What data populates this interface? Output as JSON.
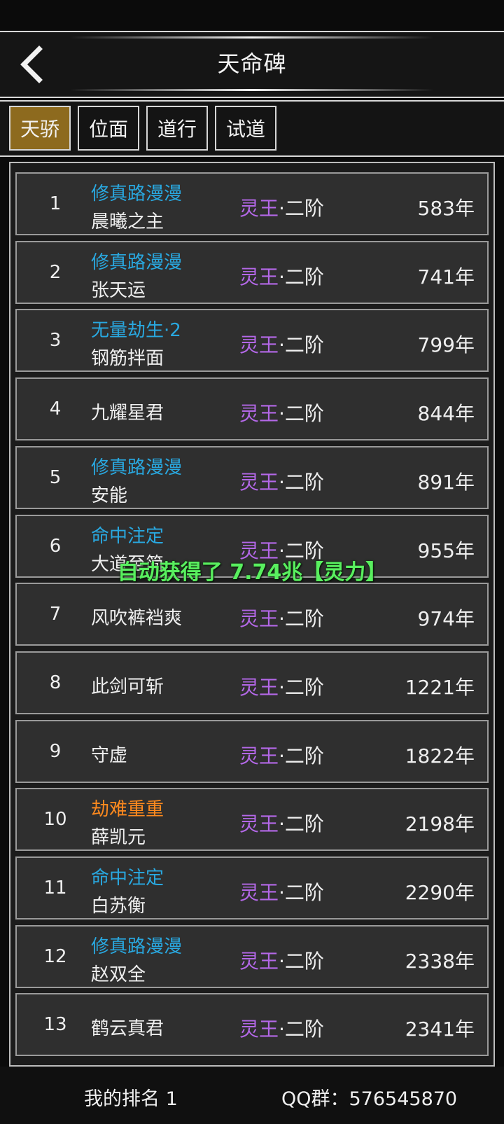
{
  "header": {
    "title": "天命碑",
    "back_icon": "chevron-left-icon"
  },
  "tabs": [
    {
      "label": "天骄",
      "active": true
    },
    {
      "label": "位面",
      "active": false
    },
    {
      "label": "道行",
      "active": false
    },
    {
      "label": "试道",
      "active": false
    }
  ],
  "colors": {
    "active_tab": "#8d6a1e",
    "title_blue": "#29a8e0",
    "title_orange": "#ff8a1e",
    "realm_purple": "#b468e8",
    "toast_green": "#59ef5f"
  },
  "realm_separator": "·",
  "year_unit": "年",
  "ranking": [
    {
      "rank": "1",
      "title": "修真路漫漫",
      "title_color": "blue",
      "name": "晨曦之主",
      "realm": "灵王",
      "stage": "二阶",
      "years": "583"
    },
    {
      "rank": "2",
      "title": "修真路漫漫",
      "title_color": "blue",
      "name": "张天运",
      "realm": "灵王",
      "stage": "二阶",
      "years": "741"
    },
    {
      "rank": "3",
      "title": "无量劫生·2",
      "title_color": "blue",
      "name": "钢筋拌面",
      "realm": "灵王",
      "stage": "二阶",
      "years": "799"
    },
    {
      "rank": "4",
      "title": "",
      "title_color": "",
      "name": "九耀星君",
      "realm": "灵王",
      "stage": "二阶",
      "years": "844"
    },
    {
      "rank": "5",
      "title": "修真路漫漫",
      "title_color": "blue",
      "name": "安能",
      "realm": "灵王",
      "stage": "二阶",
      "years": "891"
    },
    {
      "rank": "6",
      "title": "命中注定",
      "title_color": "blue",
      "name": "大道至简",
      "realm": "灵王",
      "stage": "二阶",
      "years": "955"
    },
    {
      "rank": "7",
      "title": "",
      "title_color": "",
      "name": "风吹裤裆爽",
      "realm": "灵王",
      "stage": "二阶",
      "years": "974"
    },
    {
      "rank": "8",
      "title": "",
      "title_color": "",
      "name": "此剑可斩",
      "realm": "灵王",
      "stage": "二阶",
      "years": "1221"
    },
    {
      "rank": "9",
      "title": "",
      "title_color": "",
      "name": "守虚",
      "realm": "灵王",
      "stage": "二阶",
      "years": "1822"
    },
    {
      "rank": "10",
      "title": "劫难重重",
      "title_color": "orange",
      "name": "薛凯元",
      "realm": "灵王",
      "stage": "二阶",
      "years": "2198"
    },
    {
      "rank": "11",
      "title": "命中注定",
      "title_color": "blue",
      "name": "白苏衡",
      "realm": "灵王",
      "stage": "二阶",
      "years": "2290"
    },
    {
      "rank": "12",
      "title": "修真路漫漫",
      "title_color": "blue",
      "name": "赵双全",
      "realm": "灵王",
      "stage": "二阶",
      "years": "2338"
    },
    {
      "rank": "13",
      "title": "",
      "title_color": "",
      "name": "鹤云真君",
      "realm": "灵王",
      "stage": "二阶",
      "years": "2341"
    }
  ],
  "toast": "自动获得了 7.74兆【灵力】",
  "footer": {
    "my_rank": "我的排名 1",
    "qq_group": "QQ群：576545870"
  }
}
